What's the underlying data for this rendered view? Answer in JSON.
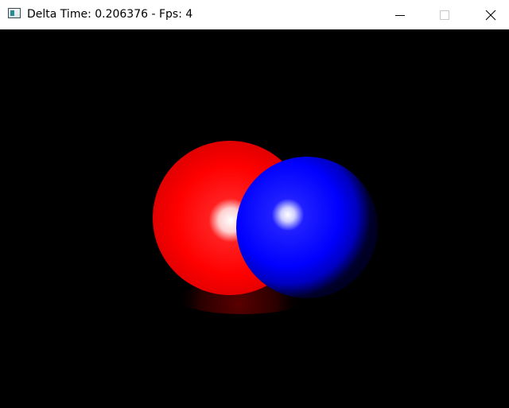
{
  "window": {
    "title": "Delta Time: 0.206376 - Fps: 4",
    "icon": "app-window-icon",
    "controls": {
      "minimize": "minimize-icon",
      "maximize": "maximize-icon",
      "close": "close-icon"
    }
  },
  "scene": {
    "background": "#000000",
    "objects": [
      {
        "name": "red-sphere",
        "color": "#ff0000",
        "highlight": "#ffffff"
      },
      {
        "name": "blue-sphere",
        "color": "#0000ff",
        "highlight": "#ffffff"
      }
    ]
  }
}
